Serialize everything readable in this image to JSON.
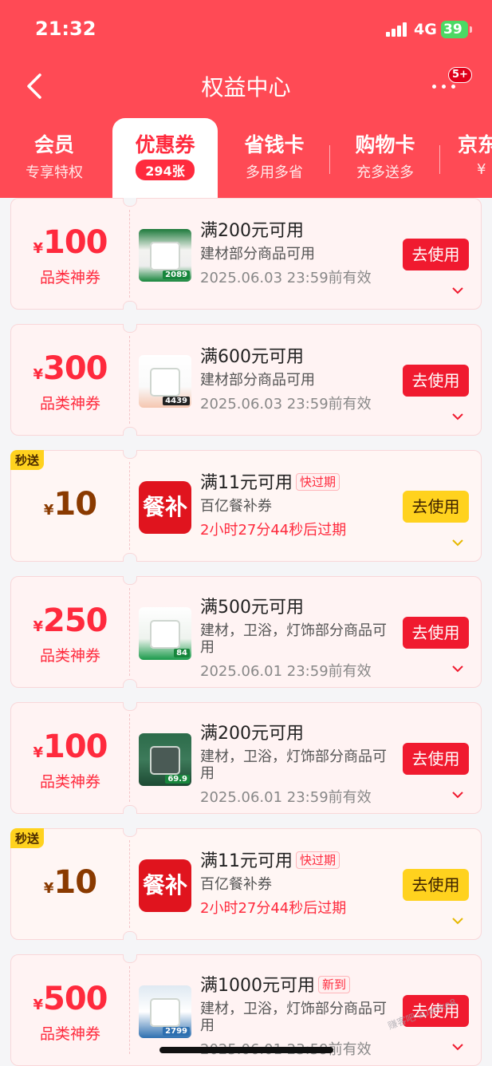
{
  "status_bar": {
    "time": "21:32",
    "network": "4G",
    "battery": "39"
  },
  "nav": {
    "title": "权益中心",
    "badge": "5+"
  },
  "tabs": [
    {
      "title": "会员",
      "sub": "专享特权"
    },
    {
      "title": "优惠券",
      "sub": "294张"
    },
    {
      "title": "省钱卡",
      "sub": "多用多省"
    },
    {
      "title": "购物卡",
      "sub": "充多送多"
    },
    {
      "title": "京东",
      "sub": "¥"
    }
  ],
  "coupons": [
    {
      "yen": "¥",
      "amount": "100",
      "label": "品类神券",
      "condition": "满200元可用",
      "desc": "建材部分商品可用",
      "expire": "2025.06.03 23:59前有效",
      "button": "去使用",
      "thumb_price": "2089"
    },
    {
      "yen": "¥",
      "amount": "300",
      "label": "品类神券",
      "condition": "满600元可用",
      "desc": "建材部分商品可用",
      "expire": "2025.06.03 23:59前有效",
      "button": "去使用",
      "thumb_price": "4439"
    },
    {
      "tag": "秒送",
      "yen": "¥",
      "amount": "10",
      "condition": "满11元可用",
      "flag": "快过期",
      "desc": "百亿餐补券",
      "expire": "2小时27分44秒后过期",
      "button": "去使用",
      "meal_icon": "餐补"
    },
    {
      "yen": "¥",
      "amount": "250",
      "label": "品类神券",
      "condition": "满500元可用",
      "desc": "建材，卫浴，灯饰部分商品可用",
      "expire": "2025.06.01 23:59前有效",
      "button": "去使用",
      "thumb_price": "84"
    },
    {
      "yen": "¥",
      "amount": "100",
      "label": "品类神券",
      "condition": "满200元可用",
      "desc": "建材，卫浴，灯饰部分商品可用",
      "expire": "2025.06.01 23:59前有效",
      "button": "去使用",
      "thumb_price": "69.9"
    },
    {
      "tag": "秒送",
      "yen": "¥",
      "amount": "10",
      "condition": "满11元可用",
      "flag": "快过期",
      "desc": "百亿餐补券",
      "expire": "2小时27分44秒后过期",
      "button": "去使用",
      "meal_icon": "餐补"
    },
    {
      "yen": "¥",
      "amount": "500",
      "label": "品类神券",
      "condition": "满1000元可用",
      "flag": "新到",
      "desc": "建材，卫浴，灯饰部分商品可用",
      "expire": "2025.06.01 23:59前有效",
      "button": "去使用",
      "thumb_price": "2799"
    }
  ],
  "watermark": "赚客吧 zuanke8"
}
